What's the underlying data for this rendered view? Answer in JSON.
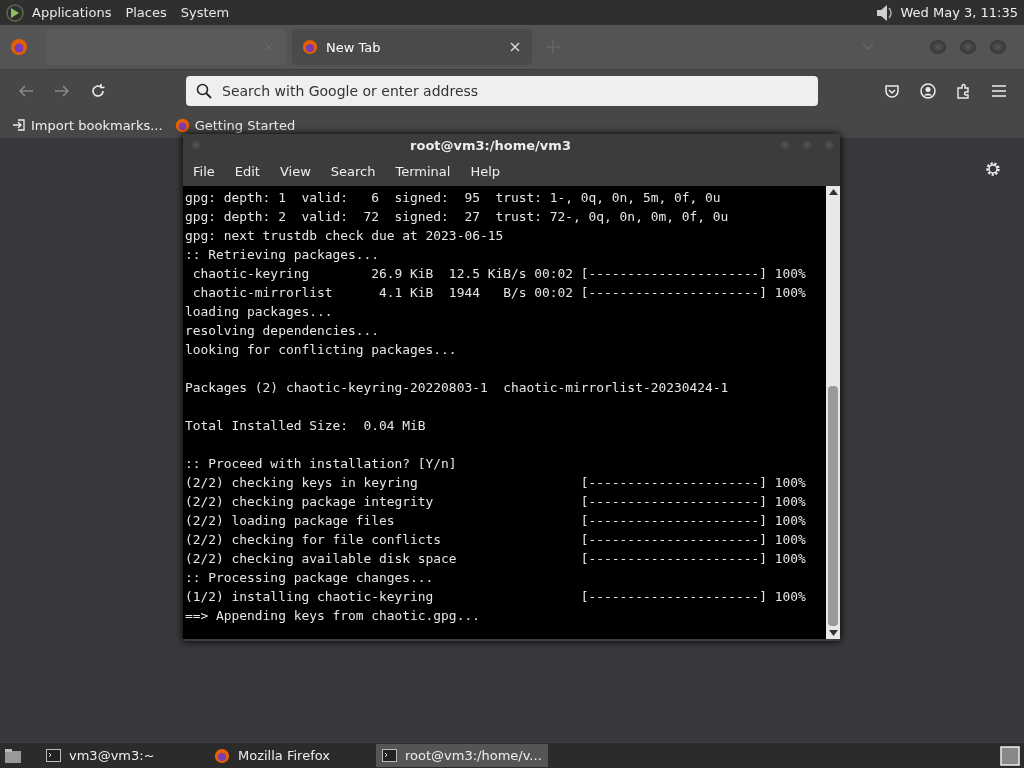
{
  "top_panel": {
    "menus": [
      "Applications",
      "Places",
      "System"
    ],
    "clock": "Wed May  3, 11:35"
  },
  "browser": {
    "tabs": [
      {
        "selected": false
      },
      {
        "title": "New Tab",
        "selected": true
      }
    ],
    "address_bar": {
      "placeholder": "Search with Google or enter address"
    },
    "bookmarks": [
      {
        "label": "Import bookmarks...",
        "kind": "import"
      },
      {
        "label": "Getting Started",
        "kind": "site"
      }
    ]
  },
  "terminal": {
    "title": "root@vm3:/home/vm3",
    "menus": [
      "File",
      "Edit",
      "View",
      "Search",
      "Terminal",
      "Help"
    ],
    "blocks": [
      [
        "gpg: depth: 1  valid:   6  signed:  95  trust: 1-, 0q, 0n, 5m, 0f, 0u",
        "gpg: depth: 2  valid:  72  signed:  27  trust: 72-, 0q, 0n, 0m, 0f, 0u",
        "gpg: next trustdb check due at 2023-06-15",
        ":: Retrieving packages...",
        " chaotic-keyring        26.9 KiB  12.5 KiB/s 00:02 [----------------------] 100%",
        " chaotic-mirrorlist      4.1 KiB  1944   B/s 00:02 [----------------------] 100%",
        "loading packages...",
        "resolving dependencies...",
        "looking for conflicting packages..."
      ],
      [
        "Packages (2) chaotic-keyring-20220803-1  chaotic-mirrorlist-20230424-1"
      ],
      [
        "Total Installed Size:  0.04 MiB"
      ],
      [
        ":: Proceed with installation? [Y/n]",
        "(2/2) checking keys in keyring                     [----------------------] 100%",
        "(2/2) checking package integrity                   [----------------------] 100%",
        "(2/2) loading package files                        [----------------------] 100%",
        "(2/2) checking for file conflicts                  [----------------------] 100%",
        "(2/2) checking available disk space                [----------------------] 100%",
        ":: Processing package changes...",
        "(1/2) installing chaotic-keyring                   [----------------------] 100%",
        "==> Appending keys from chaotic.gpg..."
      ]
    ]
  },
  "taskbar": {
    "items": [
      {
        "label": "vm3@vm3:~",
        "kind": "terminal",
        "selected": false
      },
      {
        "label": "Mozilla Firefox",
        "kind": "browser",
        "selected": false
      },
      {
        "label": "root@vm3:/home/v...",
        "kind": "terminal",
        "selected": true
      }
    ]
  }
}
